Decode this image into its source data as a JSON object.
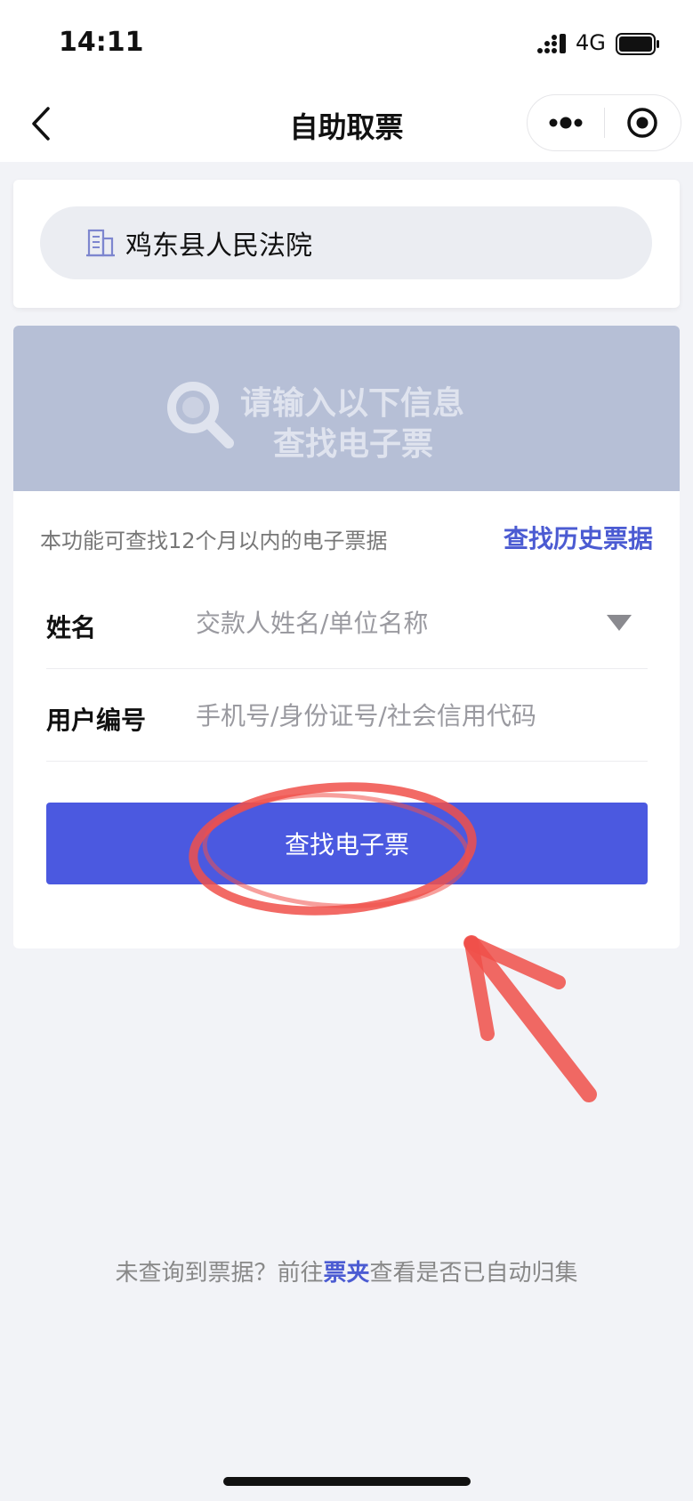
{
  "status_bar": {
    "time": "14:11",
    "network": "4G"
  },
  "nav": {
    "title": "自助取票"
  },
  "court": {
    "name": "鸡东县人民法院",
    "icon": "building-icon"
  },
  "banner": {
    "line1": "请输入以下信息",
    "line2": "查找电子票",
    "icon": "search-icon"
  },
  "search_form": {
    "hint": "本功能可查找12个月以内的电子票据",
    "history_link": "查找历史票据",
    "name_label": "姓名",
    "name_placeholder": "交款人姓名/单位名称",
    "user_id_label": "用户编号",
    "user_id_placeholder": "手机号/身份证号/社会信用代码",
    "submit_label": "查找电子票"
  },
  "footer": {
    "prefix": "未查询到票据？前往",
    "link": "票夹",
    "suffix": "查看是否已自动归集"
  },
  "colors": {
    "accent": "#4b59e0",
    "link": "#4b5bd2",
    "banner": "#b6bfd6",
    "annotation": "#f0504a"
  }
}
